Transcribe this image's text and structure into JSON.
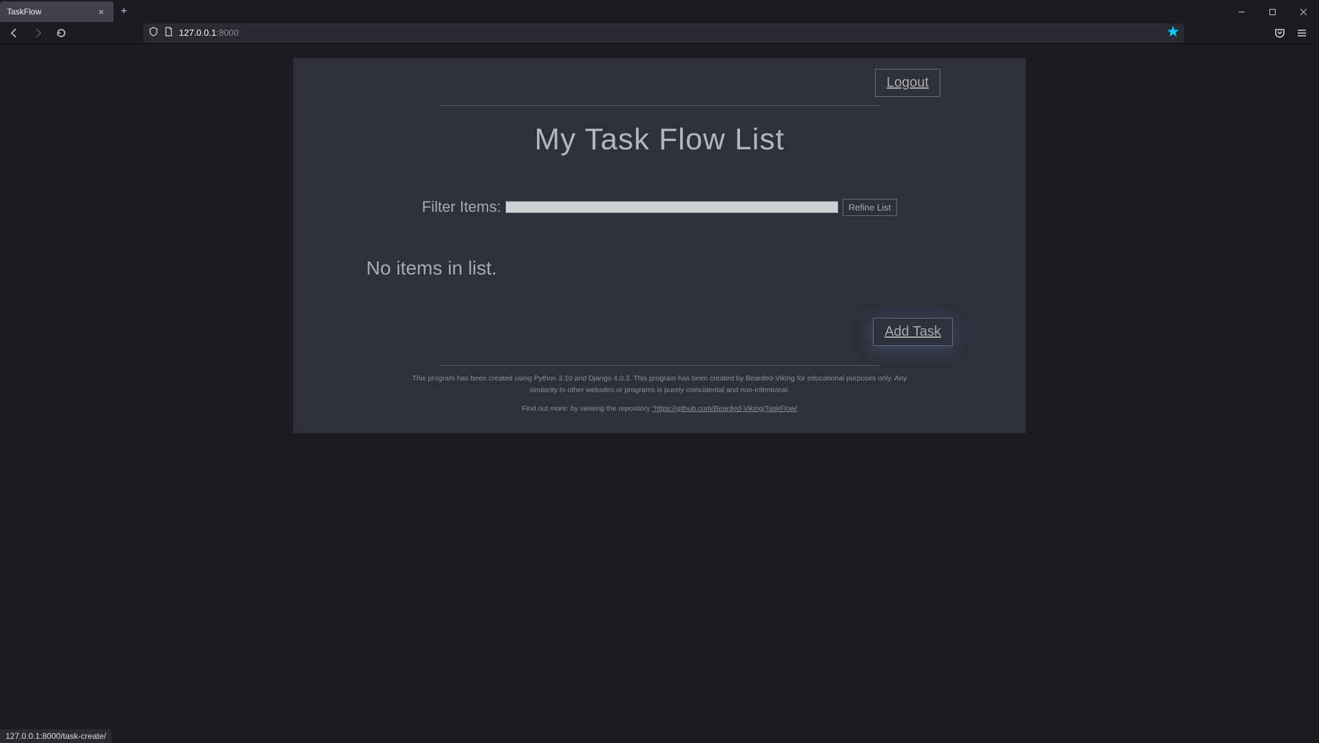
{
  "browser": {
    "tab_title": "TaskFlow",
    "url_host": "127.0.0.1",
    "url_port": ":8000",
    "status_bar": "127.0.0.1:8000/task-create/"
  },
  "page": {
    "logout_label": "Logout",
    "title": "My Task Flow List",
    "filter_label": "Filter Items:",
    "filter_value": "",
    "refine_button": "Refine List",
    "empty_message": "No items in list.",
    "add_task_label": "Add Task",
    "footer_line1": "This program has been created using Python 3.10 and Django 4.0.3. This program has been created by Bearded-Viking for educational purposes only. Any similarity to other websites or programs is purely coincidental and non-intentional.",
    "footer_find_prefix": "Find out more: by viewing the repository ",
    "footer_link_text": "\"https://github.com/Bearded-Viking/TaskFlow/"
  }
}
